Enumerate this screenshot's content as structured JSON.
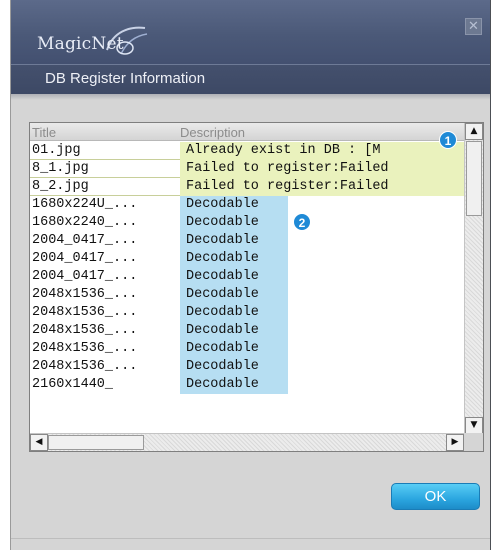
{
  "window": {
    "logo_text": "MagicNet",
    "close_label": "✕",
    "header_title": "DB Register Information"
  },
  "list": {
    "columns": [
      "Title",
      "Description"
    ],
    "rows": [
      {
        "title": "01.jpg",
        "description": "Already exist in DB :  [M",
        "status": "failed"
      },
      {
        "title": "8_1.jpg",
        "description": "Failed to register:Failed",
        "status": "failed"
      },
      {
        "title": "8_2.jpg",
        "description": "Failed to register:Failed",
        "status": "failed"
      },
      {
        "title": "1680x224U_...",
        "description": "Decodable",
        "status": "ok"
      },
      {
        "title": "1680x2240_...",
        "description": "Decodable",
        "status": "ok"
      },
      {
        "title": "2004_0417_...",
        "description": "Decodable",
        "status": "ok"
      },
      {
        "title": "2004_0417_...",
        "description": "Decodable",
        "status": "ok"
      },
      {
        "title": "2004_0417_...",
        "description": "Decodable",
        "status": "ok"
      },
      {
        "title": "2048x1536_...",
        "description": "Decodable",
        "status": "ok"
      },
      {
        "title": "2048x1536_...",
        "description": "Decodable",
        "status": "ok"
      },
      {
        "title": "2048x1536_...",
        "description": "Decodable",
        "status": "ok"
      },
      {
        "title": "2048x1536_...",
        "description": "Decodable",
        "status": "ok"
      },
      {
        "title": "2048x1536_...",
        "description": "Decodable",
        "status": "ok"
      },
      {
        "title": "2160x1440_",
        "description": "Decodable",
        "status": "ok"
      }
    ]
  },
  "callouts": {
    "one": "1",
    "two": "2"
  },
  "buttons": {
    "ok_label": "OK"
  },
  "colors": {
    "failed_bg": "#eaf2bd",
    "decodable_bg": "#b6def2",
    "header_bg": "#44506d",
    "ok_button": "#2ba6e0",
    "callout": "#1f8ad6"
  }
}
